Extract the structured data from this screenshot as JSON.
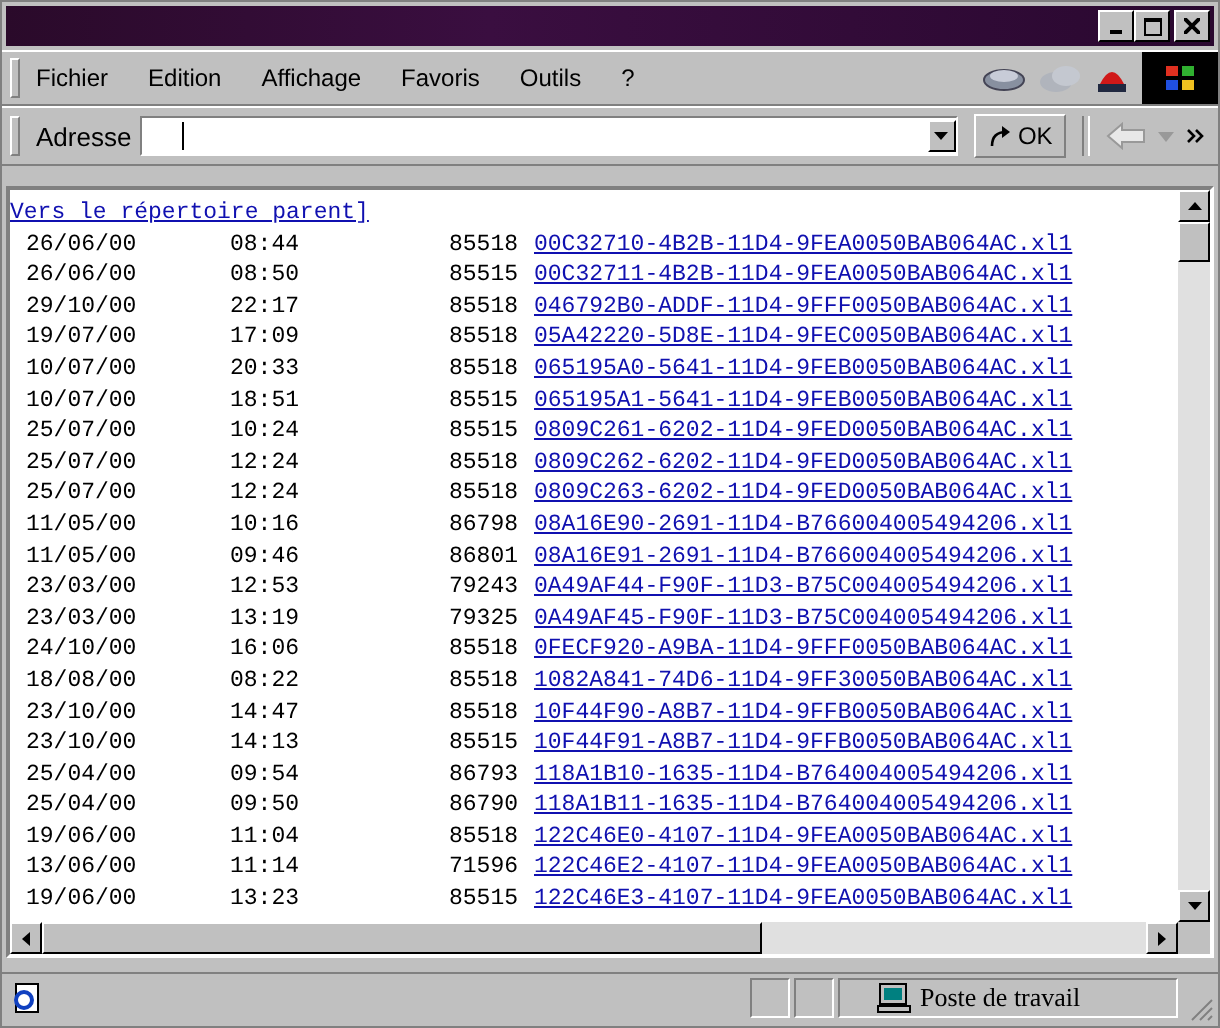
{
  "menu": [
    {
      "label": "Fichier"
    },
    {
      "label": "Edition"
    },
    {
      "label": "Affichage"
    },
    {
      "label": "Favoris"
    },
    {
      "label": "Outils"
    },
    {
      "label": "?"
    }
  ],
  "address_bar": {
    "label": "Adresse",
    "go": "OK"
  },
  "parent_link": "Vers le répertoire parent]",
  "files": [
    {
      "date": "26/06/00",
      "time": "08:44",
      "size": "85518",
      "name": "00C32710-4B2B-11D4-9FEA0050BAB064AC.xl1"
    },
    {
      "date": "26/06/00",
      "time": "08:50",
      "size": "85515",
      "name": "00C32711-4B2B-11D4-9FEA0050BAB064AC.xl1"
    },
    {
      "date": "29/10/00",
      "time": "22:17",
      "size": "85518",
      "name": "046792B0-ADDF-11D4-9FFF0050BAB064AC.xl1"
    },
    {
      "date": "19/07/00",
      "time": "17:09",
      "size": "85518",
      "name": "05A42220-5D8E-11D4-9FEC0050BAB064AC.xl1"
    },
    {
      "date": "10/07/00",
      "time": "20:33",
      "size": "85518",
      "name": "065195A0-5641-11D4-9FEB0050BAB064AC.xl1"
    },
    {
      "date": "10/07/00",
      "time": "18:51",
      "size": "85515",
      "name": "065195A1-5641-11D4-9FEB0050BAB064AC.xl1"
    },
    {
      "date": "25/07/00",
      "time": "10:24",
      "size": "85515",
      "name": "0809C261-6202-11D4-9FED0050BAB064AC.xl1"
    },
    {
      "date": "25/07/00",
      "time": "12:24",
      "size": "85518",
      "name": "0809C262-6202-11D4-9FED0050BAB064AC.xl1"
    },
    {
      "date": "25/07/00",
      "time": "12:24",
      "size": "85518",
      "name": "0809C263-6202-11D4-9FED0050BAB064AC.xl1"
    },
    {
      "date": "11/05/00",
      "time": "10:16",
      "size": "86798",
      "name": "08A16E90-2691-11D4-B766004005494206.xl1"
    },
    {
      "date": "11/05/00",
      "time": "09:46",
      "size": "86801",
      "name": "08A16E91-2691-11D4-B766004005494206.xl1"
    },
    {
      "date": "23/03/00",
      "time": "12:53",
      "size": "79243",
      "name": "0A49AF44-F90F-11D3-B75C004005494206.xl1"
    },
    {
      "date": "23/03/00",
      "time": "13:19",
      "size": "79325",
      "name": "0A49AF45-F90F-11D3-B75C004005494206.xl1"
    },
    {
      "date": "24/10/00",
      "time": "16:06",
      "size": "85518",
      "name": "0FECF920-A9BA-11D4-9FFF0050BAB064AC.xl1"
    },
    {
      "date": "18/08/00",
      "time": "08:22",
      "size": "85518",
      "name": "1082A841-74D6-11D4-9FF30050BAB064AC.xl1"
    },
    {
      "date": "23/10/00",
      "time": "14:47",
      "size": "85518",
      "name": "10F44F90-A8B7-11D4-9FFB0050BAB064AC.xl1"
    },
    {
      "date": "23/10/00",
      "time": "14:13",
      "size": "85515",
      "name": "10F44F91-A8B7-11D4-9FFB0050BAB064AC.xl1"
    },
    {
      "date": "25/04/00",
      "time": "09:54",
      "size": "86793",
      "name": "118A1B10-1635-11D4-B764004005494206.xl1"
    },
    {
      "date": "25/04/00",
      "time": "09:50",
      "size": "86790",
      "name": "118A1B11-1635-11D4-B764004005494206.xl1"
    },
    {
      "date": "19/06/00",
      "time": "11:04",
      "size": "85518",
      "name": "122C46E0-4107-11D4-9FEA0050BAB064AC.xl1"
    },
    {
      "date": "13/06/00",
      "time": "11:14",
      "size": "71596",
      "name": "122C46E2-4107-11D4-9FEA0050BAB064AC.xl1"
    },
    {
      "date": "19/06/00",
      "time": "13:23",
      "size": "85515",
      "name": "122C46E3-4107-11D4-9FEA0050BAB064AC.xl1"
    }
  ],
  "status_bar": {
    "zone": "Poste de travail"
  }
}
